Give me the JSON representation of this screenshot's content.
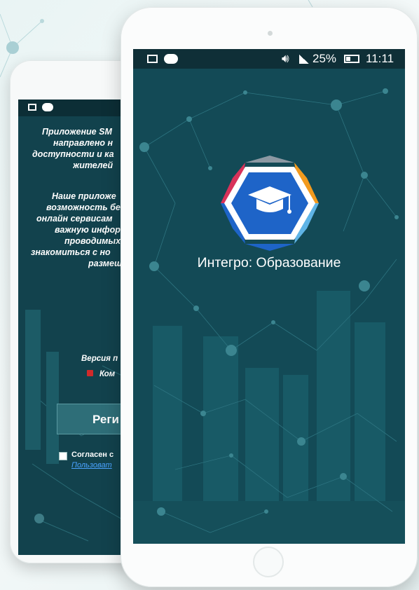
{
  "front_phone": {
    "status_bar": {
      "battery": "25%",
      "time": "11:11",
      "icons": [
        "image-icon",
        "cloud-download-icon",
        "volume-icon",
        "signal-icon",
        "battery-icon"
      ]
    },
    "app_title": "Интегро: Образование",
    "logo_icon": "graduation-cap-icon",
    "colors": {
      "screen": "#134a56",
      "logo_blue": "#1e64c8",
      "logo_orange": "#f29a1e",
      "logo_pink": "#d8325a",
      "logo_gray": "#8c99a3"
    }
  },
  "back_phone": {
    "status_bar": {
      "icons": [
        "image-icon",
        "cloud-download-icon"
      ]
    },
    "about_paragraph_lines": [
      "Приложение SM",
      "направлено н",
      "доступности и ка",
      "жителей"
    ],
    "features_paragraph_lines": [
      "Наше приложе",
      "возможность бе",
      "онлайн сервисам",
      "важную инфор",
      "проводимых",
      "знакомиться с но",
      "размещ"
    ],
    "version_label": "Версия п",
    "company_line": "Ком",
    "register_button": "Реги",
    "agree_text": "Согласен с",
    "terms_link": "Пользоват"
  }
}
